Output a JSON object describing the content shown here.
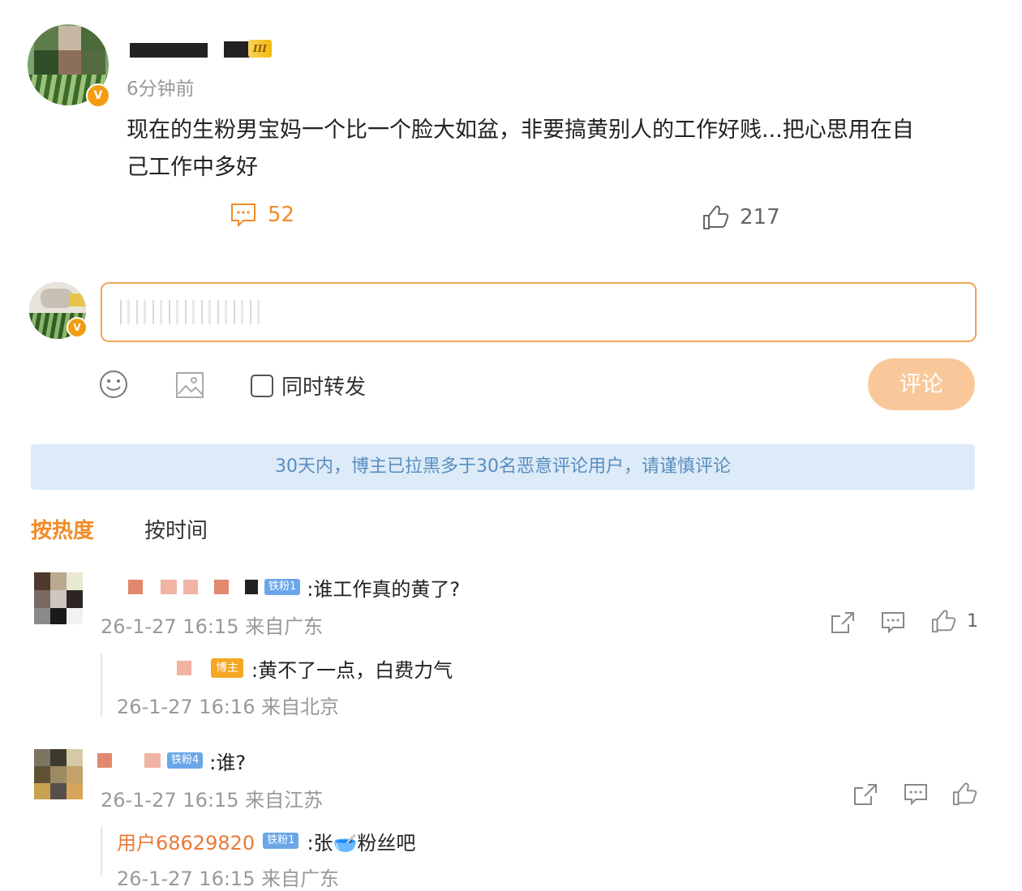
{
  "post": {
    "time": "6分钟前",
    "content_line1": "现在的生粉男宝妈一个比一个脸大如盆，非要搞黄别人的工作好贱...把心思用在自",
    "content_line2": "己工作中多好",
    "comment_count": "52",
    "like_count": "217",
    "level_badge": "III"
  },
  "composer": {
    "checkbox_label": "同时转发",
    "submit_label": "评论"
  },
  "notice": "30天内，博主已拉黑多于30名恶意评论用户，请谨慎评论",
  "sort_tabs": [
    "按热度",
    "按时间"
  ],
  "comments": [
    {
      "fan_badge": "铁粉1",
      "text": ":谁工作真的黄了?",
      "meta": "26-1-27 16:15 来自广东",
      "like_count": "1",
      "reply": {
        "badge": "博主",
        "text": ":黄不了一点，白费力气",
        "meta": "26-1-27 16:16 来自北京"
      }
    },
    {
      "fan_badge": "铁粉4",
      "text": ":谁?",
      "meta": "26-1-27 16:15 来自江苏",
      "reply": {
        "user": "用户68629820",
        "badge": "铁粉1",
        "text": ":张🥣粉丝吧",
        "meta": "26-1-27 16:15 来自广东"
      }
    }
  ],
  "colors": {
    "accent": "#f08c28",
    "notice_bg": "#dcebf7",
    "notice_text": "#5a8dc0",
    "fan_badge": "#6aa6e8",
    "host_badge": "#f5a623",
    "submit_bg": "#f9c89a"
  },
  "icons": [
    "comment-icon",
    "like-icon",
    "emoji-icon",
    "image-icon",
    "share-icon"
  ]
}
